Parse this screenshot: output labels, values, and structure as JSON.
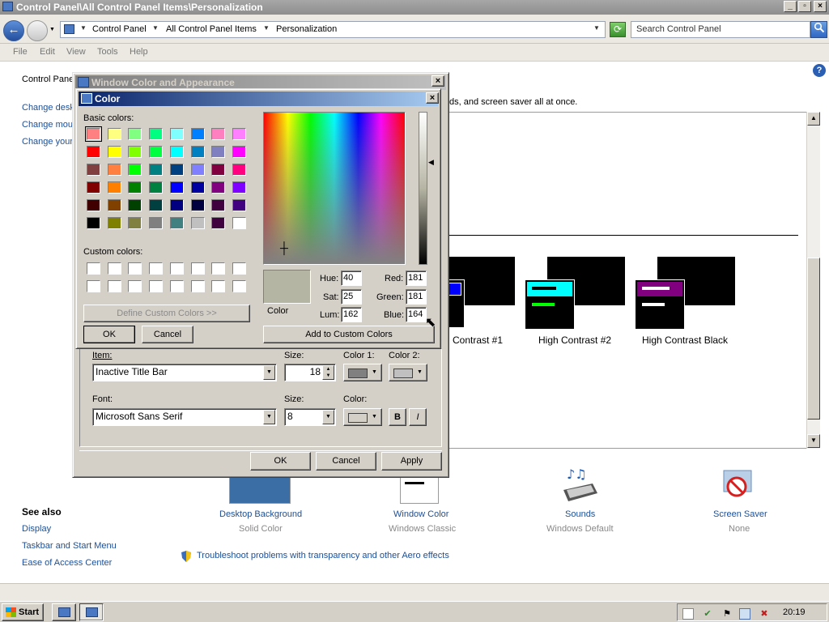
{
  "window": {
    "title": "Control Panel\\All Control Panel Items\\Personalization",
    "min_glyph": "_",
    "max_glyph": "▫",
    "close_glyph": "×"
  },
  "address": {
    "back_glyph": "←",
    "crumbs": [
      "Control Panel",
      "All Control Panel Items",
      "Personalization"
    ],
    "search_placeholder": "Search Control Panel",
    "search_icon": "search-icon",
    "refresh_glyph": "⟳",
    "dropdown_glyph": "▼"
  },
  "menu": {
    "file": "File",
    "edit": "Edit",
    "view": "View",
    "tools": "Tools",
    "help": "Help"
  },
  "left_pane": {
    "breadcrumb": "Control Panel",
    "links": [
      "Change desk",
      "Change mou",
      "Change your"
    ],
    "see_also_heading": "See also",
    "see_also": [
      "Display",
      "Taskbar and Start Menu",
      "Ease of Access Center"
    ]
  },
  "main": {
    "intro_text": "ds, and screen saver all at once.",
    "help_glyph": "?",
    "themes": [
      {
        "label": "Contrast #1",
        "accent": "#0000ff"
      },
      {
        "label": "High Contrast #2",
        "accent": "#00ffff"
      },
      {
        "label": "High Contrast Black",
        "accent": "#800080"
      }
    ],
    "bottom_items": [
      {
        "label": "Desktop Background",
        "sub": "Solid Color"
      },
      {
        "label": "Window Color",
        "sub": "Windows Classic"
      },
      {
        "label": "Sounds",
        "sub": "Windows Default"
      },
      {
        "label": "Screen Saver",
        "sub": "None"
      }
    ],
    "desktop_color": "#3a6ea5",
    "troubleshoot": "Troubleshoot problems with transparency and other Aero effects"
  },
  "wca_dialog": {
    "title": "Window Color and Appearance",
    "close_glyph": "×",
    "item_label": "Item:",
    "item_value": "Inactive Title Bar",
    "size_label": "Size:",
    "size_value": "18",
    "color1_label": "Color 1:",
    "color2_label": "Color 2:",
    "color1": "#808080",
    "color2": "#c0c0c0",
    "font_label": "Font:",
    "font_value": "Microsoft Sans Serif",
    "font_size_label": "Size:",
    "font_size_value": "8",
    "font_color_label": "Color:",
    "bold": "B",
    "italic": "I",
    "ok": "OK",
    "cancel": "Cancel",
    "apply": "Apply"
  },
  "color_dialog": {
    "title": "Color",
    "close_glyph": "×",
    "basic_label": "Basic colors:",
    "custom_label": "Custom colors:",
    "define_button": "Define Custom Colors >>",
    "ok": "OK",
    "cancel": "Cancel",
    "add_button": "Add to Custom Colors",
    "color_label": "Color",
    "hue_label": "Hue:",
    "hue": "40",
    "sat_label": "Sat:",
    "sat": "25",
    "lum_label": "Lum:",
    "lum": "162",
    "red_label": "Red:",
    "red": "181",
    "green_label": "Green:",
    "green": "181",
    "blue_label": "Blue:",
    "blue": "164",
    "preview_color": "#b5b5a4",
    "basic_colors": [
      "#ff8080",
      "#ffff80",
      "#80ff80",
      "#00ff80",
      "#80ffff",
      "#0080ff",
      "#ff80c0",
      "#ff80ff",
      "#ff0000",
      "#ffff00",
      "#80ff00",
      "#00ff40",
      "#00ffff",
      "#0080c0",
      "#8080c0",
      "#ff00ff",
      "#804040",
      "#ff8040",
      "#00ff00",
      "#008080",
      "#004080",
      "#8080ff",
      "#800040",
      "#ff0080",
      "#800000",
      "#ff8000",
      "#008000",
      "#008040",
      "#0000ff",
      "#0000a0",
      "#800080",
      "#8000ff",
      "#400000",
      "#804000",
      "#004000",
      "#004040",
      "#000080",
      "#000040",
      "#400040",
      "#400080",
      "#000000",
      "#808000",
      "#808040",
      "#808080",
      "#408080",
      "#c0c0c0",
      "#400040",
      "#ffffff"
    ]
  },
  "taskbar": {
    "start": "Start",
    "clock": "20:19"
  }
}
